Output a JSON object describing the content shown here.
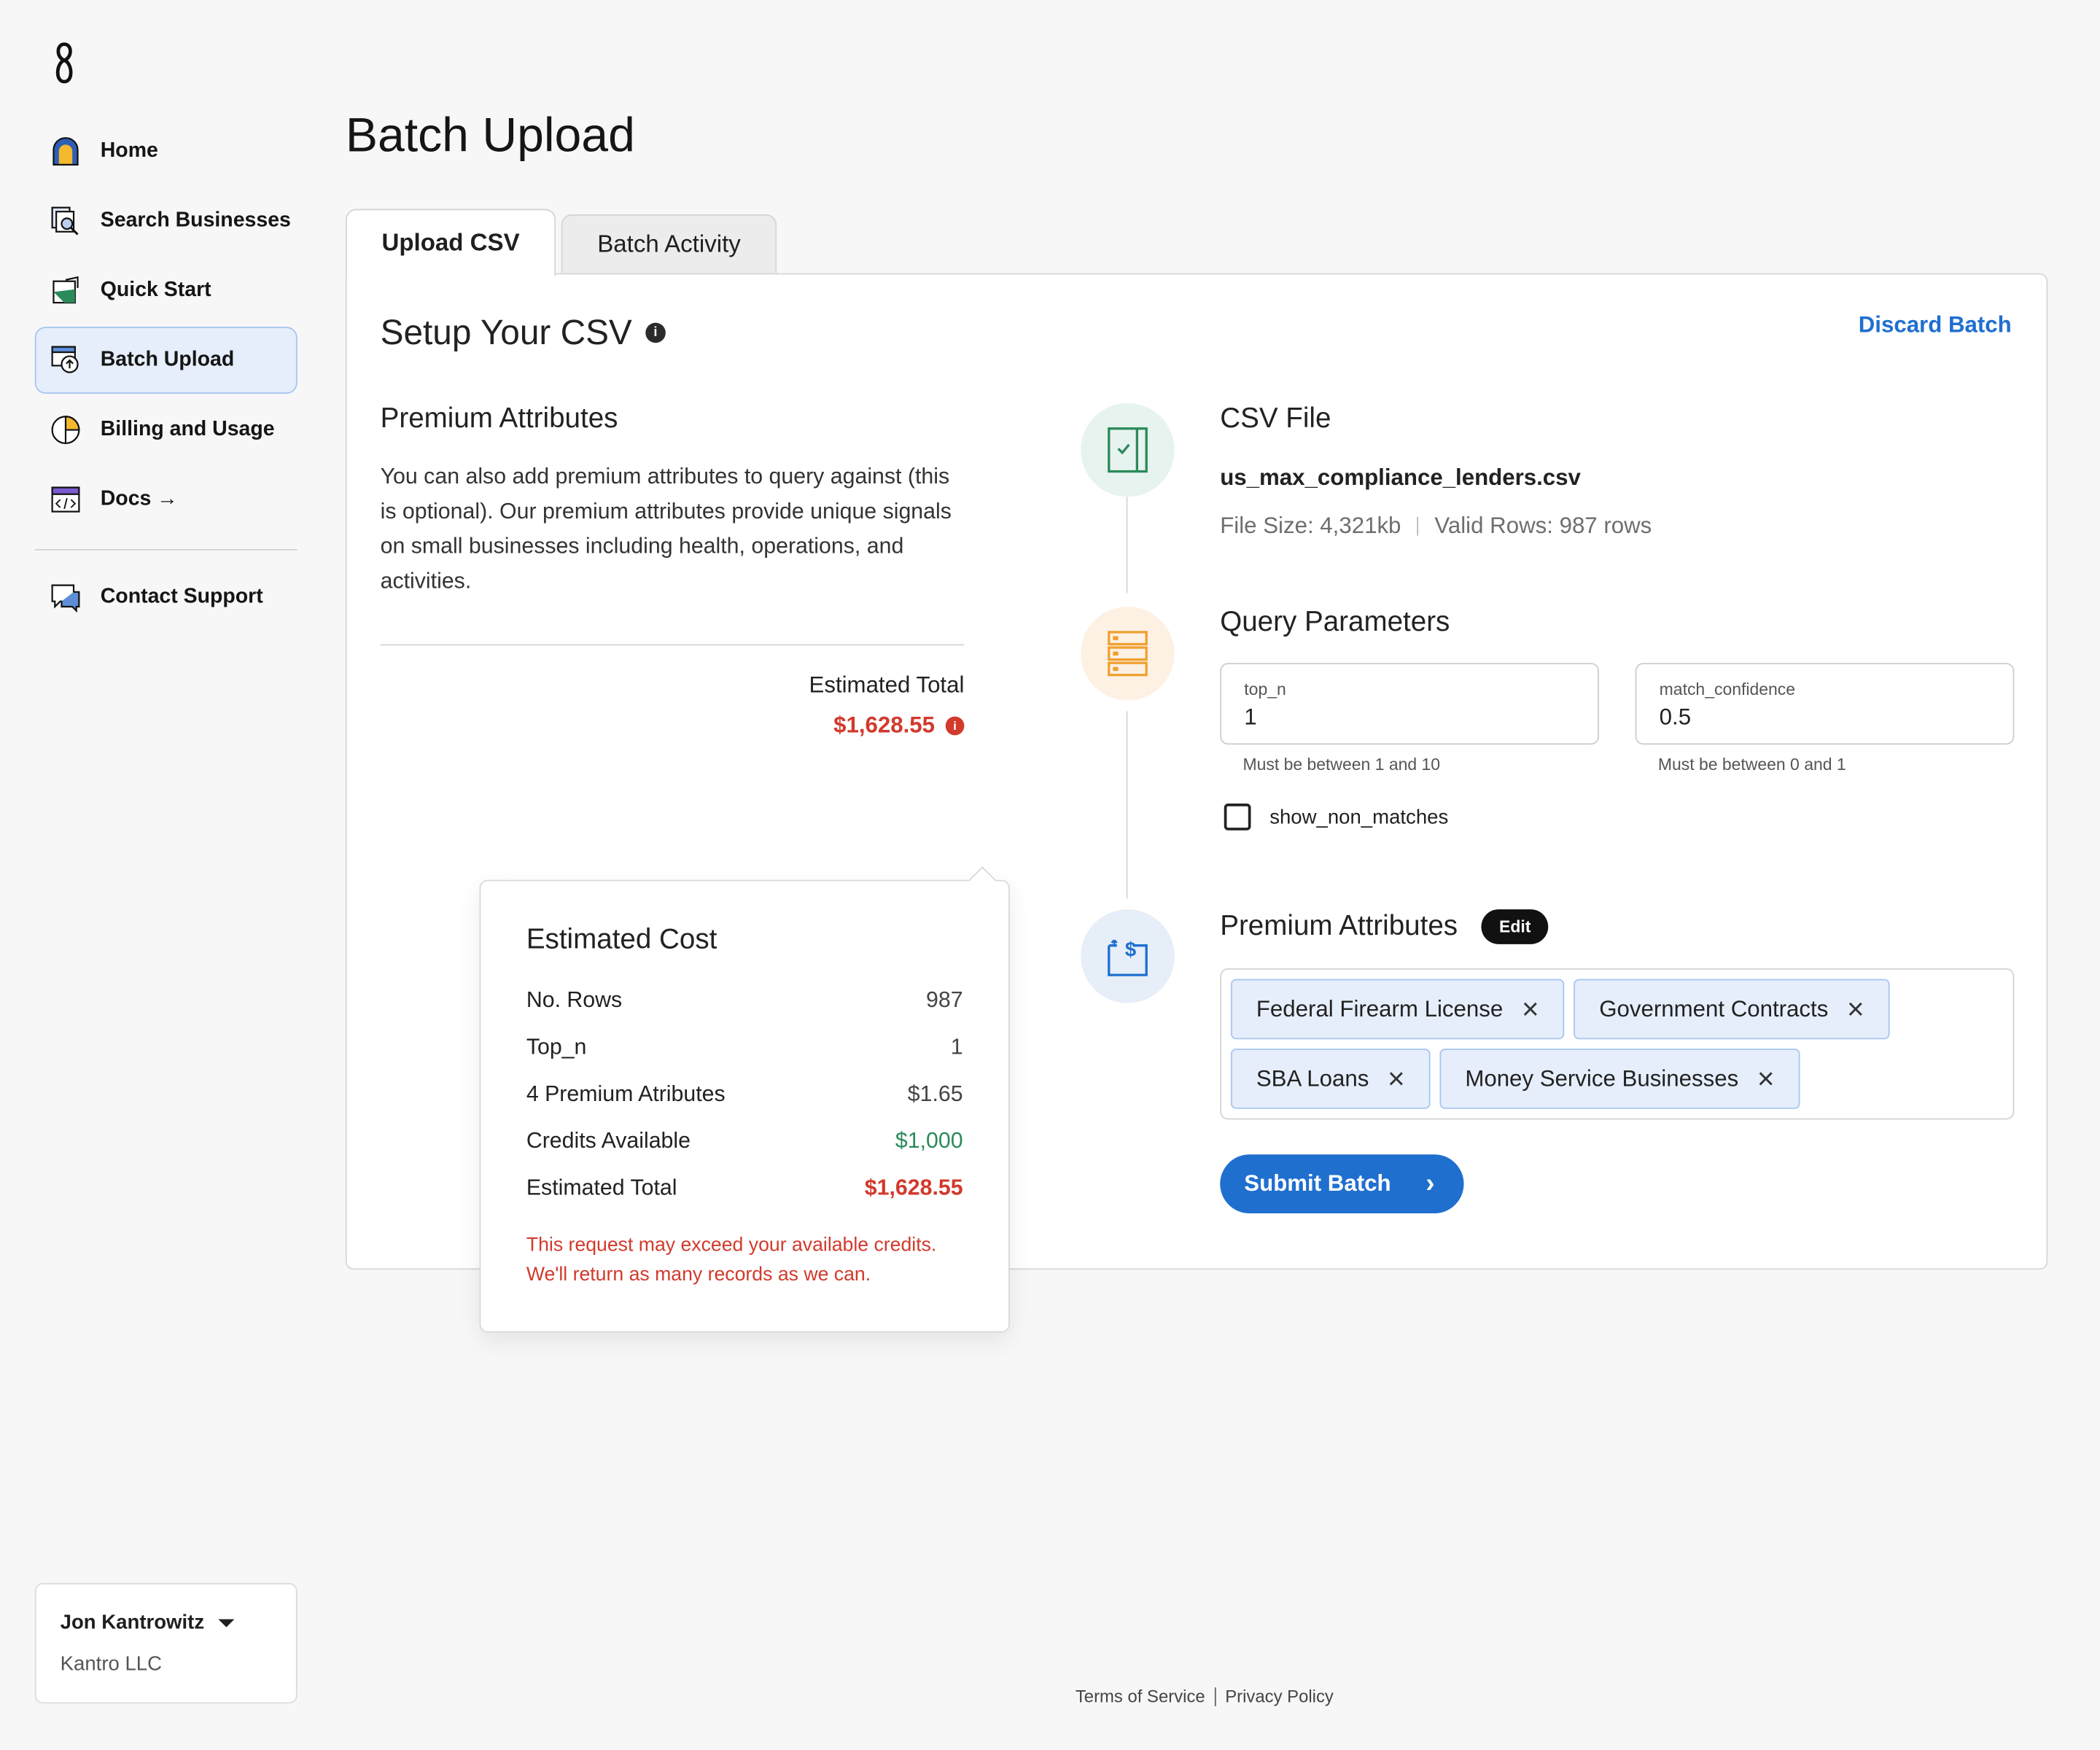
{
  "sidebar": {
    "items": [
      {
        "label": "Home"
      },
      {
        "label": "Search Businesses"
      },
      {
        "label": "Quick Start"
      },
      {
        "label": "Batch Upload"
      },
      {
        "label": "Billing and Usage"
      },
      {
        "label": "Docs →"
      },
      {
        "label": "Contact Support"
      }
    ],
    "user": {
      "name": "Jon Kantrowitz",
      "org": "Kantro LLC"
    }
  },
  "page": {
    "title": "Batch Upload"
  },
  "tabs": [
    {
      "label": "Upload CSV"
    },
    {
      "label": "Batch Activity"
    }
  ],
  "setup": {
    "title": "Setup Your CSV",
    "discard_label": "Discard Batch"
  },
  "left": {
    "title": "Premium Attributes",
    "description": "You can also add premium attributes to query against (this is optional). Our premium attributes provide unique signals on small businesses including health, operations, and activities.",
    "estimated_total_label": "Estimated Total",
    "estimated_total_value": "$1,628.55"
  },
  "tooltip": {
    "title": "Estimated Cost",
    "rows": [
      {
        "label": "No. Rows",
        "value": "987"
      },
      {
        "label": "Top_n",
        "value": "1"
      },
      {
        "label": "4 Premium Atributes",
        "value": "$1.65"
      },
      {
        "label": "Credits Available",
        "value": "$1,000"
      },
      {
        "label": "Estimated Total",
        "value": "$1,628.55"
      }
    ],
    "warning_line1": "This request may exceed your available credits.",
    "warning_line2": "We'll return as many records as we can."
  },
  "csv": {
    "title": "CSV File",
    "file_name": "us_max_compliance_lenders.csv",
    "file_size": "File Size: 4,321kb",
    "valid_rows": "Valid Rows: 987 rows"
  },
  "query": {
    "title": "Query Parameters",
    "top_n": {
      "label": "top_n",
      "value": "1",
      "help": "Must be between 1 and 10"
    },
    "match_confidence": {
      "label": "match_confidence",
      "value": "0.5",
      "help": "Must be between 0 and 1"
    },
    "show_non_matches": {
      "label": "show_non_matches",
      "checked": false
    }
  },
  "premium": {
    "title": "Premium Attributes",
    "edit_label": "Edit",
    "chips": [
      "Federal Firearm License",
      "Government Contracts",
      "SBA Loans",
      "Money Service Businesses"
    ],
    "submit_label": "Submit Batch"
  },
  "footer": {
    "terms": "Terms of Service",
    "privacy": "Privacy Policy"
  },
  "colors": {
    "accent": "#1f6fcf",
    "error": "#d23a2c",
    "success": "#2a8a5a",
    "selected_bg": "#e6eefb"
  }
}
